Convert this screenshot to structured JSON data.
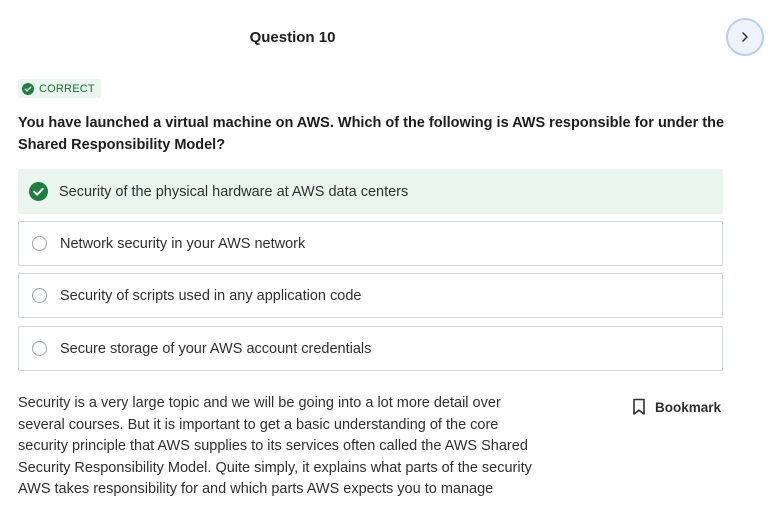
{
  "question": {
    "title": "Question 10",
    "status": "CORRECT",
    "text": "You have launched a virtual machine on AWS. Which of the following is AWS responsible for under the Shared Responsibility Model?"
  },
  "answers": [
    {
      "label": "Security of the physical hardware at AWS data centers",
      "state": "correct"
    },
    {
      "label": "Network security in your AWS network",
      "state": "unselected"
    },
    {
      "label": "Security of scripts used in any application code",
      "state": "unselected"
    },
    {
      "label": "Secure storage of your AWS account credentials",
      "state": "unselected"
    }
  ],
  "explanation": "Security is a very large topic and we will be going into a lot more detail over several courses. But it is important to get a basic understanding of the core security principle that AWS supplies to its services often called the AWS Shared Security Responsibility Model. Quite simply, it explains what parts of the security AWS takes responsibility for and which parts AWS expects you to manage",
  "bookmark_label": "Bookmark",
  "icons": {
    "next": "chevron-right-icon",
    "badge": "check-circle-icon",
    "bookmark": "bookmark-icon"
  },
  "colors": {
    "correct_bg": "#eaf5ee",
    "correct_green": "#1e6b3c",
    "check_fill": "#1d7e40",
    "next_btn_border": "#b8cdf6"
  }
}
